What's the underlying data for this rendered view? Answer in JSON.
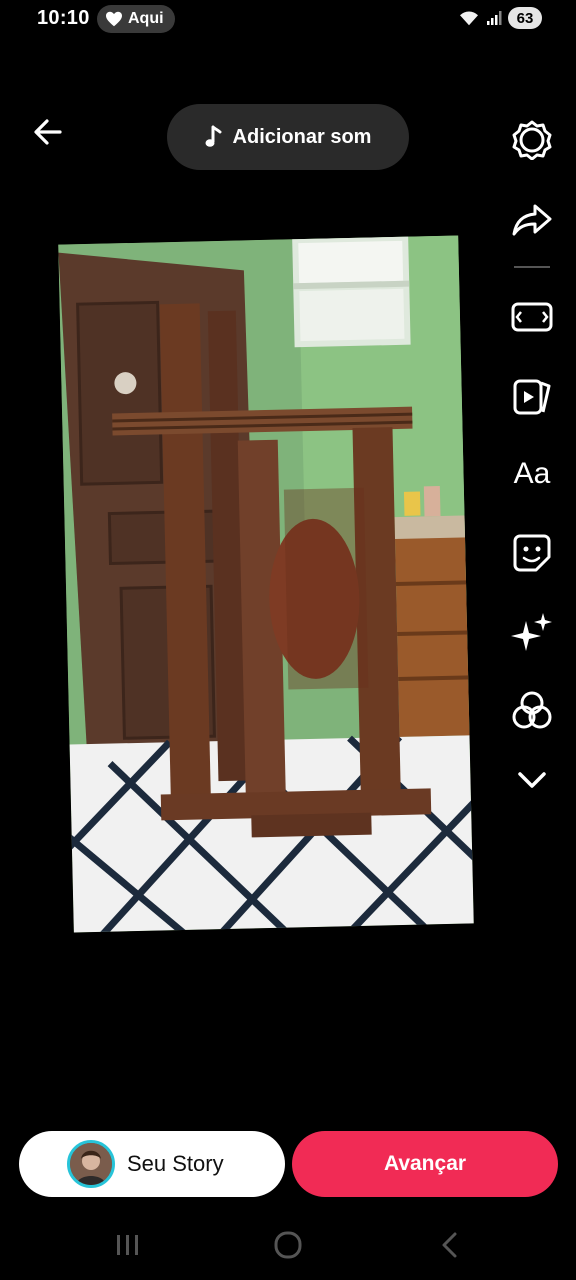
{
  "status_bar": {
    "time": "10:10",
    "location_label": "Aqui",
    "battery": "63"
  },
  "header": {
    "add_sound_label": "Adicionar som"
  },
  "toolbar": {
    "items": [
      {
        "name": "settings-icon"
      },
      {
        "name": "share-icon"
      },
      {
        "name": "ratio-icon"
      },
      {
        "name": "templates-icon"
      },
      {
        "name": "text-tool",
        "label": "Aa"
      },
      {
        "name": "sticker-icon"
      },
      {
        "name": "effects-icon"
      },
      {
        "name": "filters-icon"
      },
      {
        "name": "chevron-down-icon"
      }
    ]
  },
  "footer": {
    "story_label": "Seu Story",
    "next_label": "Avançar"
  },
  "colors": {
    "accent": "#f12b55",
    "avatar_ring": "#27c4d9",
    "pill_bg": "#2a2a2a"
  }
}
